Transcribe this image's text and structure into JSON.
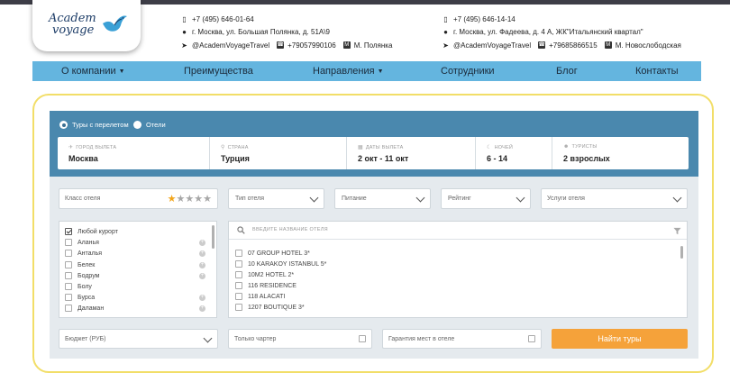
{
  "logo": {
    "line1": "Academ",
    "line2": "voyage"
  },
  "contacts": [
    {
      "phone": "+7 (495) 646-01-64",
      "address": "г. Москва, ул. Большая Полянка, д. 51А\\9",
      "telegram": "@AcademVoyageTravel",
      "whatsapp": "+79057990106",
      "metro_letter": "M",
      "metro": "М. Полянка"
    },
    {
      "phone": "+7 (495) 646-14-14",
      "address": "г. Москва, ул. Фадеева, д. 4 А, ЖК\"Итальянский квартал\"",
      "telegram": "@AcademVoyageTravel",
      "whatsapp": "+79685866515",
      "metro_letter": "M",
      "metro": "М. Новослободская"
    }
  ],
  "nav": [
    {
      "label": "О компании",
      "has_caret": true
    },
    {
      "label": "Преимущества",
      "has_caret": false
    },
    {
      "label": "Направления",
      "has_caret": true
    },
    {
      "label": "Сотрудники",
      "has_caret": false
    },
    {
      "label": "Блог",
      "has_caret": false
    },
    {
      "label": "Контакты",
      "has_caret": false
    }
  ],
  "search": {
    "mode_options": [
      "Туры с перелетом",
      "Отели"
    ],
    "mode_selected": "Туры с перелетом",
    "fields": [
      {
        "label": "ГОРОД ВЫЛЕТА",
        "value": "Москва",
        "icon": "plane-icon"
      },
      {
        "label": "СТРАНА",
        "value": "Турция",
        "icon": "location-pin-icon"
      },
      {
        "label": "ДАТЫ ВЫЛЕТА",
        "value": "2 окт - 11 окт",
        "icon": "calendar-icon"
      },
      {
        "label": "НОЧЕЙ",
        "value": "6 - 14",
        "icon": "moon-icon"
      },
      {
        "label": "ТУРИСТЫ",
        "value": "2 взрослых",
        "icon": "person-icon"
      }
    ],
    "filters": {
      "hotel_class": "Класс отеля",
      "hotel_class_stars_selected": 1,
      "hotel_type": "Тип отеля",
      "meals": "Питание",
      "rating": "Рейтинг",
      "services": "Услуги отеля"
    },
    "resorts": [
      {
        "label": "Любой курорт",
        "checked": true,
        "expandable": false
      },
      {
        "label": "Аланья",
        "checked": false,
        "expandable": true
      },
      {
        "label": "Анталья",
        "checked": false,
        "expandable": true
      },
      {
        "label": "Белек",
        "checked": false,
        "expandable": true
      },
      {
        "label": "Бодрум",
        "checked": false,
        "expandable": true
      },
      {
        "label": "Болу",
        "checked": false,
        "expandable": false
      },
      {
        "label": "Бурса",
        "checked": false,
        "expandable": true
      },
      {
        "label": "Даламан",
        "checked": false,
        "expandable": true
      }
    ],
    "hotel_search_placeholder": "ВВЕДИТЕ НАЗВАНИЕ ОТЕЛЯ",
    "hotels": [
      "07 GROUP HOTEL 3*",
      "10 KARAKOY ISTANBUL 5*",
      "10M2 HOTEL 2*",
      "116 RESIDENCE",
      "118 ALACATI",
      "1207 BOUTIQUE 3*"
    ],
    "budget": "Бюджет (РУБ)",
    "charter_only": "Только чартер",
    "guaranteed_seats": "Гарантия мест в отеле",
    "submit": "Найти туры"
  },
  "colors": {
    "nav_bg": "#64b5df",
    "search_header_bg": "#4a88ae",
    "panel_border": "#f2de68",
    "submit_bg": "#f5a23a",
    "star_active": "#f2a51b"
  }
}
